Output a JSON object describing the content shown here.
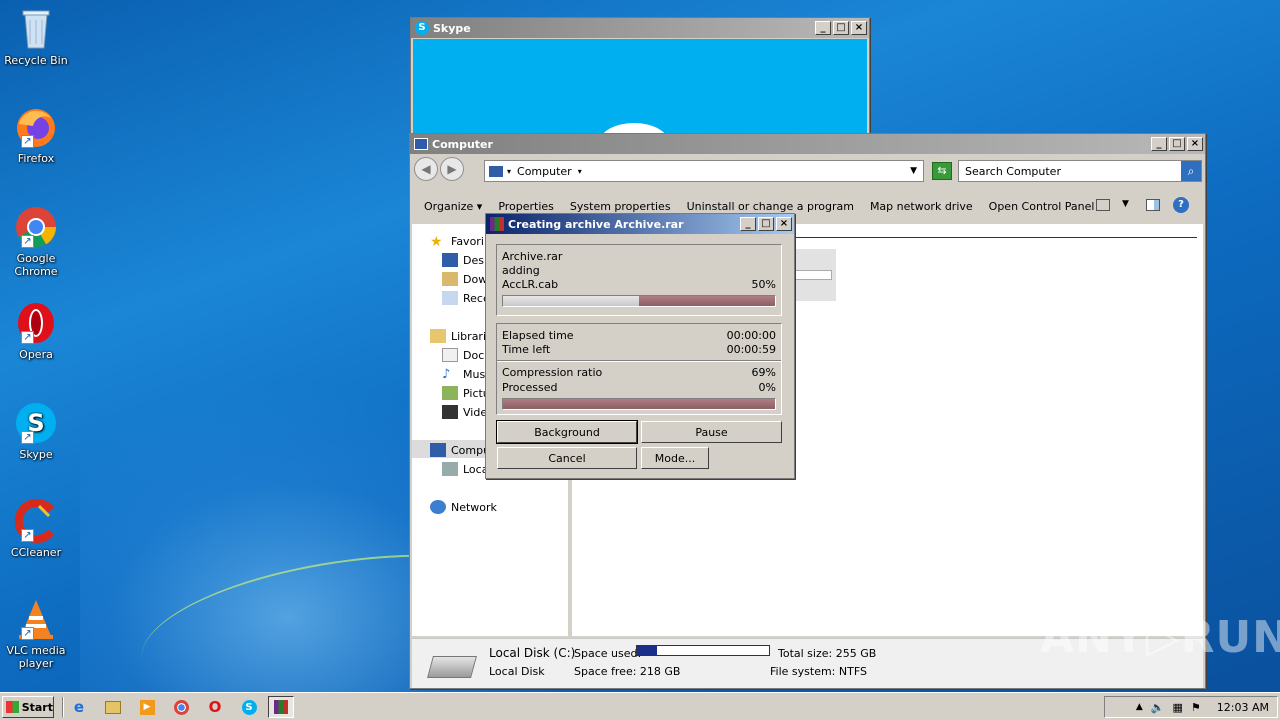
{
  "desktop": {
    "icons": [
      {
        "label": "Recycle Bin",
        "icon": "recycle-bin-icon"
      },
      {
        "label": "Firefox",
        "icon": "firefox-icon"
      },
      {
        "label": "Google Chrome",
        "icon": "chrome-icon"
      },
      {
        "label": "Opera",
        "icon": "opera-icon"
      },
      {
        "label": "Skype",
        "icon": "skype-icon"
      },
      {
        "label": "CCleaner",
        "icon": "ccleaner-icon"
      },
      {
        "label": "VLC media player",
        "icon": "vlc-icon"
      }
    ],
    "watermark": "ANY▷RUN"
  },
  "skype_window": {
    "title": "Skype",
    "accent": "#00aff0"
  },
  "explorer": {
    "title": "Computer",
    "address": "Computer",
    "search_placeholder": "Search Computer",
    "toolbar": [
      "Organize ▾",
      "Properties",
      "System properties",
      "Uninstall or change a program",
      "Map network drive",
      "Open Control Panel"
    ],
    "nav": {
      "favorites": "Favori",
      "desktop": "Desk",
      "downloads": "Dow",
      "recent": "Rece",
      "libraries": "Librari",
      "documents": "Docu",
      "music": "Musi",
      "pictures": "Pictu",
      "videos": "Vide",
      "computer": "Compu",
      "local": "Loca",
      "network": "Network"
    },
    "details": {
      "drive_name": "Local Disk  (C:)",
      "drive_type": "Local Disk",
      "space_used_label": "Space used:",
      "space_used_fraction": 0.15,
      "space_free": "Space free:  218 GB",
      "total_size": "Total size:  255 GB",
      "file_system": "File system:  NTFS"
    }
  },
  "winrar": {
    "title": "Creating archive Archive.rar",
    "archive": "Archive.rar",
    "action": "adding",
    "file": "AccLR.cab",
    "file_percent": "50%",
    "file_progress": 0.5,
    "elapsed_label": "Elapsed time",
    "elapsed": "00:00:00",
    "left_label": "Time left",
    "left": "00:00:59",
    "ratio_label": "Compression ratio",
    "ratio": "69%",
    "processed_label": "Processed",
    "processed": "0%",
    "processed_progress": 0.0,
    "buttons": {
      "background": "Background",
      "pause": "Pause",
      "cancel": "Cancel",
      "mode": "Mode..."
    }
  },
  "taskbar": {
    "start": "Start",
    "clock": "12:03 AM"
  }
}
